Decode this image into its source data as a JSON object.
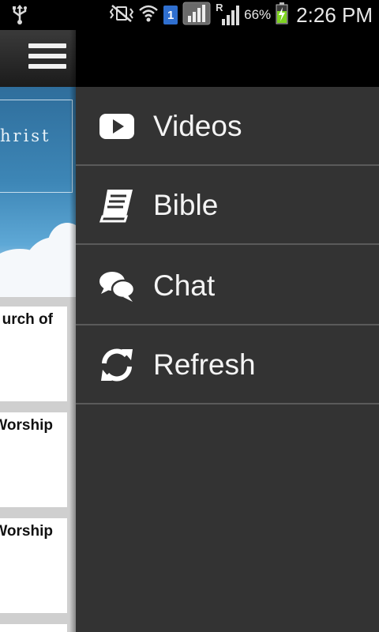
{
  "status_bar": {
    "battery_percent": "66%",
    "time": "2:26 PM",
    "sim_slot": "1",
    "roaming_indicator": "R",
    "icons": [
      "usb-icon",
      "vibrate-icon",
      "wifi-icon",
      "sim-icon",
      "signal-icon",
      "roaming-signal-icon",
      "battery-charging-icon"
    ]
  },
  "background_app": {
    "banner_text": "hrist",
    "cards": [
      {
        "title": "urch of"
      },
      {
        "title": "Worship"
      },
      {
        "title": "Worship"
      }
    ]
  },
  "drawer": {
    "items": [
      {
        "label": "Videos",
        "icon": "video-play-icon"
      },
      {
        "label": "Bible",
        "icon": "book-icon"
      },
      {
        "label": "Chat",
        "icon": "chat-bubbles-icon"
      },
      {
        "label": "Refresh",
        "icon": "refresh-icon"
      }
    ]
  },
  "colors": {
    "drawer_bg": "#333333",
    "divider": "#5a5a5a",
    "statusbar_bg": "#000000",
    "sim_badge": "#2f6fcf",
    "battery_green": "#7ed321"
  }
}
